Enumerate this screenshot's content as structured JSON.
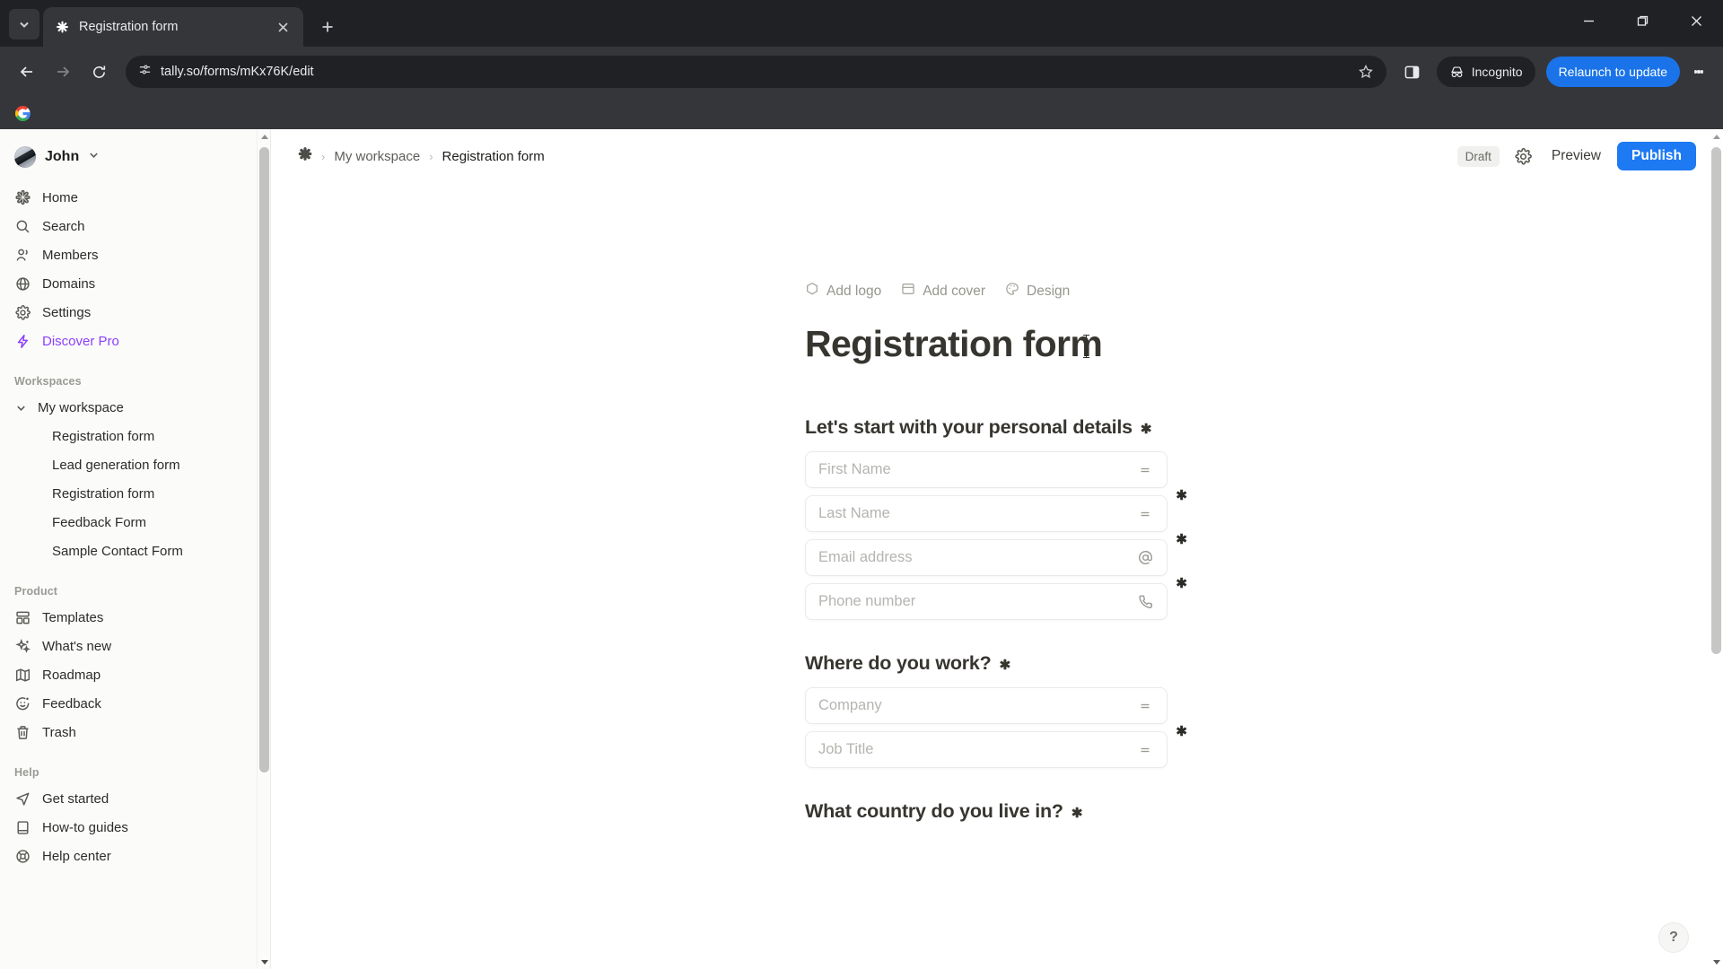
{
  "browser": {
    "tab": {
      "title": "Registration form",
      "favicon": "asterisk-icon"
    },
    "url": "tally.so/forms/mKx76K/edit",
    "incognito_label": "Incognito",
    "relaunch_label": "Relaunch to update",
    "bookmarks": [
      {
        "name": "google-bookmark"
      }
    ]
  },
  "sidebar": {
    "user": {
      "name": "John"
    },
    "nav": [
      {
        "label": "Home",
        "icon": "asterisk-icon"
      },
      {
        "label": "Search",
        "icon": "search-icon"
      },
      {
        "label": "Members",
        "icon": "members-icon"
      },
      {
        "label": "Domains",
        "icon": "globe-icon"
      },
      {
        "label": "Settings",
        "icon": "gear-icon"
      },
      {
        "label": "Discover Pro",
        "icon": "lightning-icon",
        "accent": "#8b3ffd"
      }
    ],
    "workspaces_label": "Workspaces",
    "workspace": {
      "label": "My workspace"
    },
    "forms": [
      {
        "label": "Registration form"
      },
      {
        "label": "Lead generation form"
      },
      {
        "label": "Registration form"
      },
      {
        "label": "Feedback Form"
      },
      {
        "label": "Sample Contact Form"
      }
    ],
    "product_label": "Product",
    "product": [
      {
        "label": "Templates",
        "icon": "templates-icon"
      },
      {
        "label": "What's new",
        "icon": "sparkles-icon"
      },
      {
        "label": "Roadmap",
        "icon": "map-icon"
      },
      {
        "label": "Feedback",
        "icon": "smiley-icon"
      },
      {
        "label": "Trash",
        "icon": "trash-icon"
      }
    ],
    "help_label": "Help",
    "help": [
      {
        "label": "Get started",
        "icon": "send-icon"
      },
      {
        "label": "How-to guides",
        "icon": "book-icon"
      },
      {
        "label": "Help center",
        "icon": "lifebuoy-icon"
      }
    ]
  },
  "topbar": {
    "breadcrumb": {
      "workspace": "My workspace",
      "current": "Registration form",
      "separator": "›"
    },
    "draft_label": "Draft",
    "preview_label": "Preview",
    "publish_label": "Publish",
    "publish_color": "#1d7af3"
  },
  "form": {
    "actions": [
      {
        "label": "Add logo",
        "icon": "hexagon-icon"
      },
      {
        "label": "Add cover",
        "icon": "cover-image-icon"
      },
      {
        "label": "Design",
        "icon": "palette-icon"
      }
    ],
    "title": "Registration form",
    "required_marker": "✱",
    "blocks": [
      {
        "question": "Let's start with your personal details",
        "required": true,
        "fields": [
          {
            "placeholder": "First Name",
            "icon": "drag-handle-icon",
            "required": false
          },
          {
            "placeholder": "Last Name",
            "icon": "drag-handle-icon",
            "required": true
          },
          {
            "placeholder": "Email address",
            "icon": "at-icon",
            "required": true
          },
          {
            "placeholder": "Phone number",
            "icon": "phone-icon",
            "required": true
          }
        ]
      },
      {
        "question": "Where do you work?",
        "required": true,
        "fields": [
          {
            "placeholder": "Company",
            "icon": "drag-handle-icon",
            "required": false
          },
          {
            "placeholder": "Job Title",
            "icon": "drag-handle-icon",
            "required": true
          }
        ]
      },
      {
        "question": "What country do you live in?",
        "required": true,
        "fields": []
      }
    ],
    "help_button_label": "?"
  }
}
